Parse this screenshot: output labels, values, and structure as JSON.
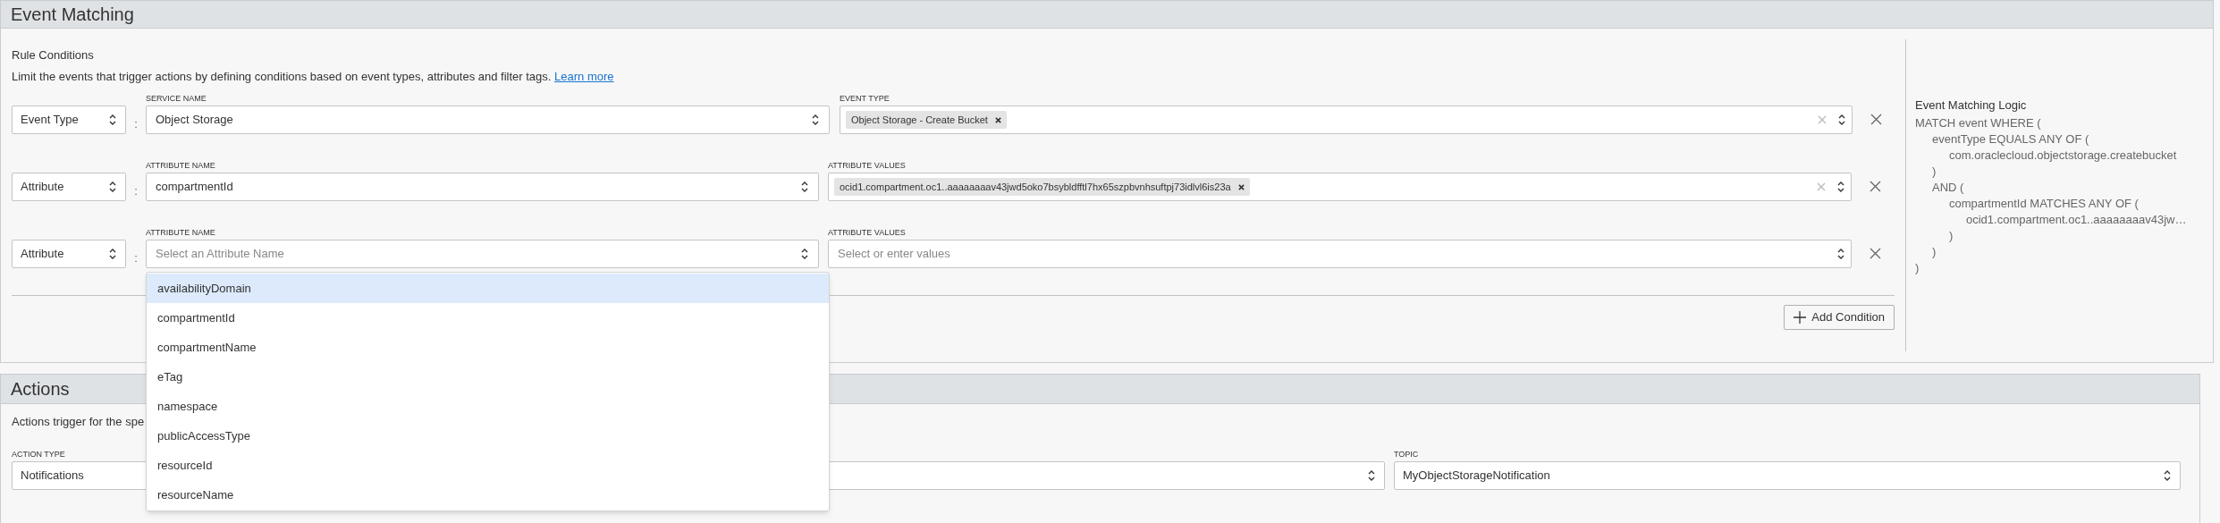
{
  "event_matching": {
    "title": "Event Matching",
    "subtitle": "Rule Conditions",
    "description": "Limit the events that trigger actions by defining conditions based on event types, attributes and filter tags.",
    "learn_more": "Learn more",
    "conditions": [
      {
        "type": "Event Type",
        "separator": ":",
        "name_label": "SERVICE NAME",
        "name_value": "Object Storage",
        "values_label": "EVENT TYPE",
        "values": [
          "Object Storage - Create Bucket"
        ]
      },
      {
        "type": "Attribute",
        "separator": ":",
        "name_label": "ATTRIBUTE NAME",
        "name_value": "compartmentId",
        "values_label": "ATTRIBUTE VALUES",
        "values": [
          "ocid1.compartment.oc1..aaaaaaaav43jwd5oko7bsybldfftl7hx65szpbvnhsuftpj73idlvl6is23a"
        ]
      },
      {
        "type": "Attribute",
        "separator": ":",
        "name_label": "ATTRIBUTE NAME",
        "name_placeholder": "Select an Attribute Name",
        "values_label": "ATTRIBUTE VALUES",
        "values_placeholder": "Select or enter values",
        "expanded": true,
        "options": [
          {
            "label": "availabilityDomain",
            "selected": true
          },
          {
            "label": "compartmentId",
            "selected": false
          },
          {
            "label": "compartmentName",
            "selected": false
          },
          {
            "label": "eTag",
            "selected": false
          },
          {
            "label": "namespace",
            "selected": false
          },
          {
            "label": "publicAccessType",
            "selected": false
          },
          {
            "label": "resourceId",
            "selected": false
          },
          {
            "label": "resourceName",
            "selected": false
          }
        ]
      }
    ],
    "add_condition": "Add Condition",
    "logic": {
      "title": "Event Matching Logic",
      "lines": [
        {
          "text": "MATCH event WHERE (",
          "children": [
            {
              "text": "eventType EQUALS ANY OF (",
              "children": [
                {
                  "text": "com.oraclecloud.objectstorage.createbucket"
                }
              ]
            },
            {
              "text": ")"
            },
            {
              "text": "AND (",
              "children": [
                {
                  "text": "compartmentId MATCHES ANY OF (",
                  "children": [
                    {
                      "text": "ocid1.compartment.oc1..aaaaaaaav43jw…"
                    }
                  ]
                },
                {
                  "text": ")"
                }
              ]
            },
            {
              "text": ")"
            }
          ]
        },
        {
          "text": ")"
        }
      ]
    }
  },
  "actions": {
    "title": "Actions",
    "description": "Actions trigger for the spe",
    "action_type_label": "ACTION TYPE",
    "action_type": "Notifications",
    "topic_label": "TOPIC",
    "topic": "MyObjectStorageNotification"
  }
}
